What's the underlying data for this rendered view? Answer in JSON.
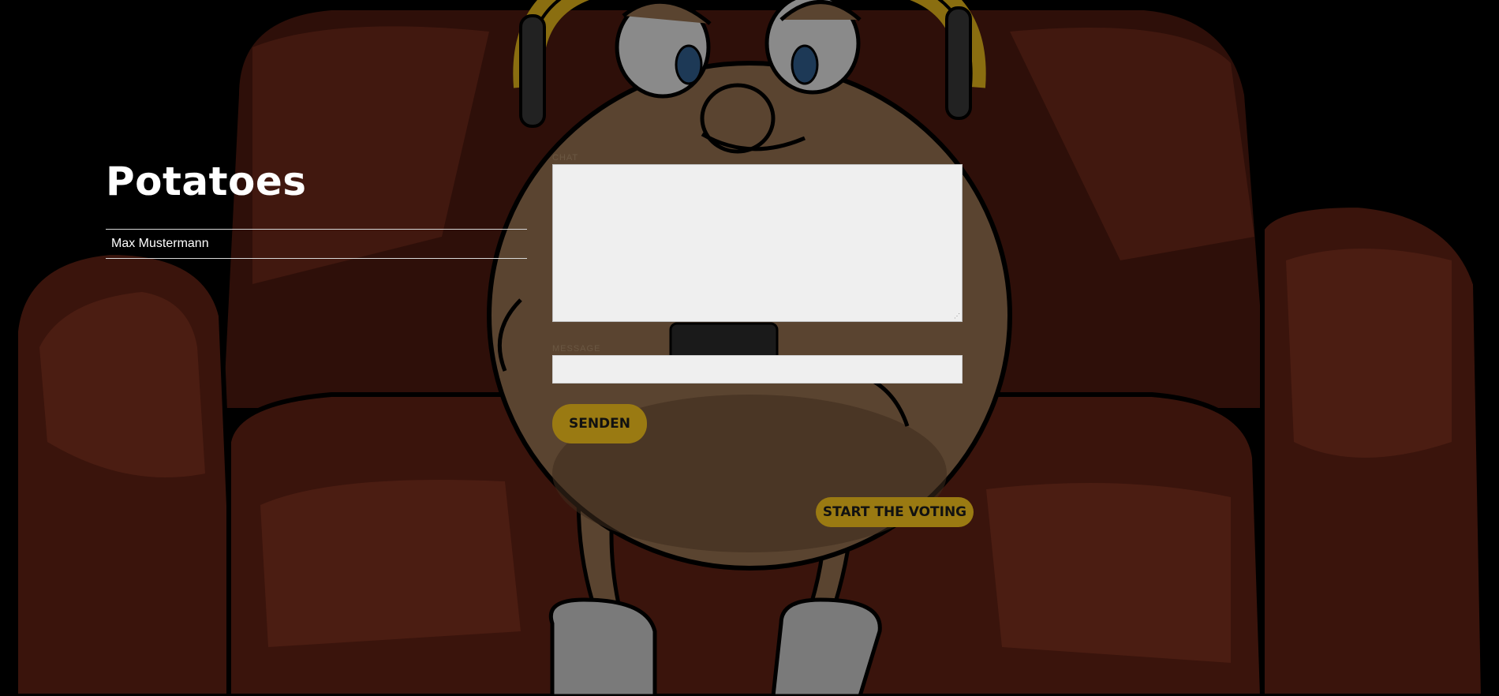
{
  "room": {
    "title": "Potatoes",
    "users": [
      "Max Mustermann"
    ]
  },
  "chat": {
    "label": "Chat",
    "log": ""
  },
  "message": {
    "label": "Message",
    "value": "",
    "placeholder": ""
  },
  "buttons": {
    "send": "SENDEN",
    "start_voting": "START THE VOTING"
  },
  "colors": {
    "accent": "#9a7a12",
    "background": "#000000",
    "sofa": "#3a140c",
    "potato": "#5a4430"
  }
}
